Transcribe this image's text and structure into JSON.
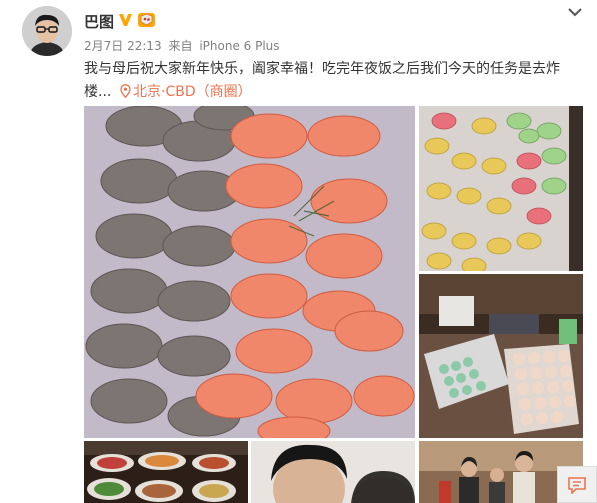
{
  "post": {
    "username": "巴图",
    "timestamp": "2月7日 22:13",
    "source_prefix": "来自",
    "source_device": "iPhone 6 Plus",
    "text": "我与母后祝大家新年快乐，阖家幸福！吃完年夜饭之后我们今天的任务是去炸楼...",
    "location": "北京·CBD（商圈）"
  },
  "icons": {
    "vip": "weibo-verified-icon",
    "level": "member-level-icon",
    "more": "chevron-down-icon",
    "location": "location-pin-icon",
    "feedback": "feedback-icon"
  },
  "photos": [
    {
      "name": "dumplings-tray-photo"
    },
    {
      "name": "colorful-dumplings-photo"
    },
    {
      "name": "dumpling-making-photo"
    },
    {
      "name": "dinner-table-photo"
    },
    {
      "name": "selfie-photo"
    },
    {
      "name": "family-gathering-photo"
    }
  ],
  "colors": {
    "accent": "#eb7350",
    "link": "#eb7350",
    "meta": "#808080",
    "vip": "#ffa500"
  }
}
